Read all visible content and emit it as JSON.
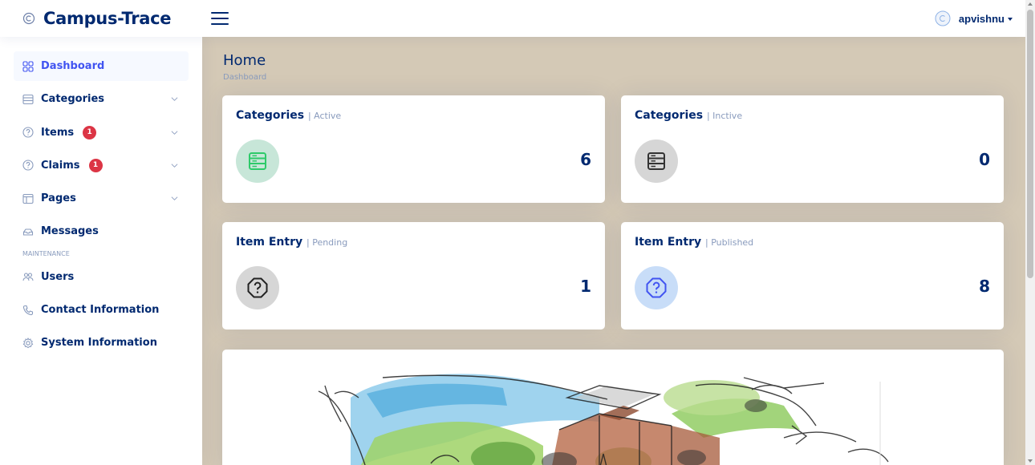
{
  "brand": {
    "name": "Campus-Trace"
  },
  "user": {
    "name": "apvishnu"
  },
  "sidebar": {
    "items": [
      {
        "label": "Dashboard",
        "icon": "grid-icon",
        "active": true
      },
      {
        "label": "Categories",
        "icon": "menu-list-icon",
        "expandable": true
      },
      {
        "label": "Items",
        "icon": "question-circle-icon",
        "badge": "1",
        "expandable": true
      },
      {
        "label": "Claims",
        "icon": "question-circle-icon",
        "badge": "1",
        "expandable": true
      },
      {
        "label": "Pages",
        "icon": "layout-icon",
        "expandable": true
      },
      {
        "label": "Messages",
        "icon": "envelope-icon"
      }
    ],
    "heading": "MAINTENANCE",
    "maintenance_items": [
      {
        "label": "Users",
        "icon": "people-icon"
      },
      {
        "label": "Contact Information",
        "icon": "telephone-icon"
      },
      {
        "label": "System Information",
        "icon": "gear-icon"
      }
    ]
  },
  "page": {
    "title": "Home",
    "breadcrumb": "Dashboard"
  },
  "cards": [
    {
      "title": "Categories",
      "subtitle": "| Active",
      "value": "6",
      "icon": "menu-list-icon",
      "color": "#2eca6a"
    },
    {
      "title": "Categories",
      "subtitle": "| Inctive",
      "value": "0",
      "icon": "menu-list-icon",
      "color": "#333333"
    },
    {
      "title": "Item Entry",
      "subtitle": "| Pending",
      "value": "1",
      "icon": "question-octagon-icon",
      "color": "#222222"
    },
    {
      "title": "Item Entry",
      "subtitle": "| Published",
      "value": "8",
      "icon": "question-octagon-icon",
      "color": "#4154f1"
    }
  ],
  "colors": {
    "primary": "#012970",
    "accent": "#4154f1",
    "background": "#d4c9b6",
    "badge": "#dc3545"
  }
}
